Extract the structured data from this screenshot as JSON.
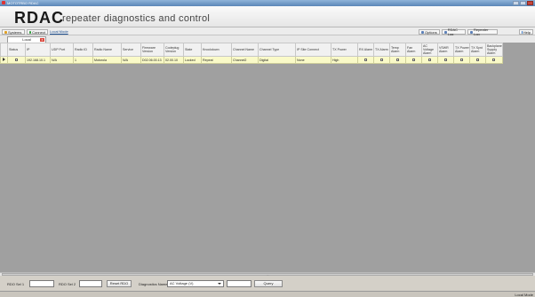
{
  "window": {
    "title": "MOTOTRBO RDAC"
  },
  "banner": {
    "logo": "RDAC",
    "subtitle": "repeater diagnostics and control"
  },
  "toolbar": {
    "left": [
      {
        "label": "Systems",
        "color": "#e0a020"
      },
      {
        "label": "Connect",
        "color": "#2e9b3a"
      }
    ],
    "local_mode": "Local Mode",
    "right": [
      {
        "label": "Options",
        "color": "#5a7fb8"
      },
      {
        "label": "RDAC Log",
        "color": "#5a7fb8"
      },
      {
        "label": "Repeater Log",
        "color": "#5a7fb8"
      },
      {
        "label": "Help",
        "color": "#2f6fbf"
      }
    ]
  },
  "tab": {
    "label": "Local",
    "close": "x"
  },
  "table": {
    "headers": [
      "Status",
      "IP",
      "UDP Port",
      "Radio ID",
      "Radio Name",
      "Service",
      "Firmware Version",
      "Codeplug Version",
      "State",
      "Knockdown",
      "Channel Name",
      "Channel Type",
      "IP Site Connect",
      "TX Power",
      "RX Alarm",
      "TX Alarm",
      "Temp Alarm",
      "Fan Alarm",
      "AC Voltage Alarm",
      "VSWR Alarm",
      "TX Power Alarm",
      "TX Synt Alarm",
      "Backplane Supply Alarm"
    ],
    "rows": [
      [
        "",
        "192.168.10.1",
        "N/A",
        "1",
        "Motorola",
        "N/A",
        "D02.06.00.13",
        "02.00.10",
        "Locked",
        "Repeat",
        "Channel2",
        "Digital",
        "None",
        "High",
        "",
        "",
        "",
        "",
        "",
        "",
        "",
        "",
        ""
      ]
    ]
  },
  "bottom": {
    "rdo_sel1_label": "RDO Sel 1",
    "rdo_sel2_label": "RDO Sel 2",
    "reset_label": "Reset RDO",
    "diag_label": "Diagnostics Name",
    "diag_value": "AC Voltage (V)",
    "query_label": "Query"
  },
  "status": {
    "text": "Local Mode"
  }
}
